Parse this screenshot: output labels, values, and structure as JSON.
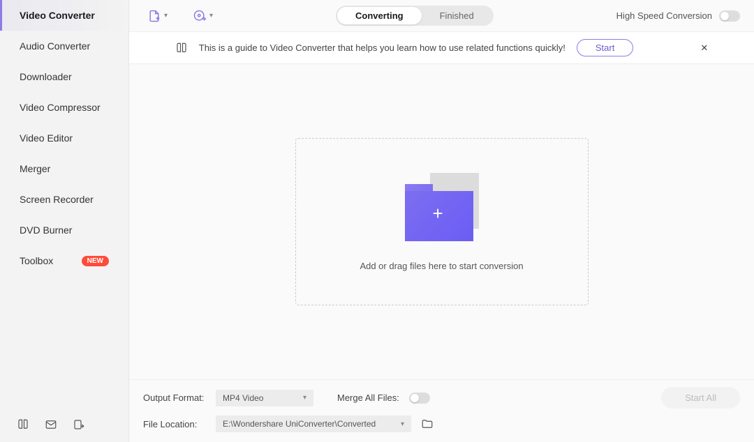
{
  "sidebar": {
    "items": [
      {
        "label": "Video Converter"
      },
      {
        "label": "Audio Converter"
      },
      {
        "label": "Downloader"
      },
      {
        "label": "Video Compressor"
      },
      {
        "label": "Video Editor"
      },
      {
        "label": "Merger"
      },
      {
        "label": "Screen Recorder"
      },
      {
        "label": "DVD Burner"
      },
      {
        "label": "Toolbox"
      }
    ],
    "new_badge": "NEW"
  },
  "toolbar": {
    "tabs": {
      "converting": "Converting",
      "finished": "Finished"
    },
    "high_speed_label": "High Speed Conversion"
  },
  "guide": {
    "text": "This is a guide to Video Converter that helps you learn how to use related functions quickly!",
    "start": "Start"
  },
  "dropzone": {
    "text": "Add or drag files here to start conversion"
  },
  "bottom": {
    "output_format_label": "Output Format:",
    "output_format_value": "MP4 Video",
    "merge_label": "Merge All Files:",
    "file_location_label": "File Location:",
    "file_location_value": "E:\\Wondershare UniConverter\\Converted",
    "start_all": "Start All"
  }
}
